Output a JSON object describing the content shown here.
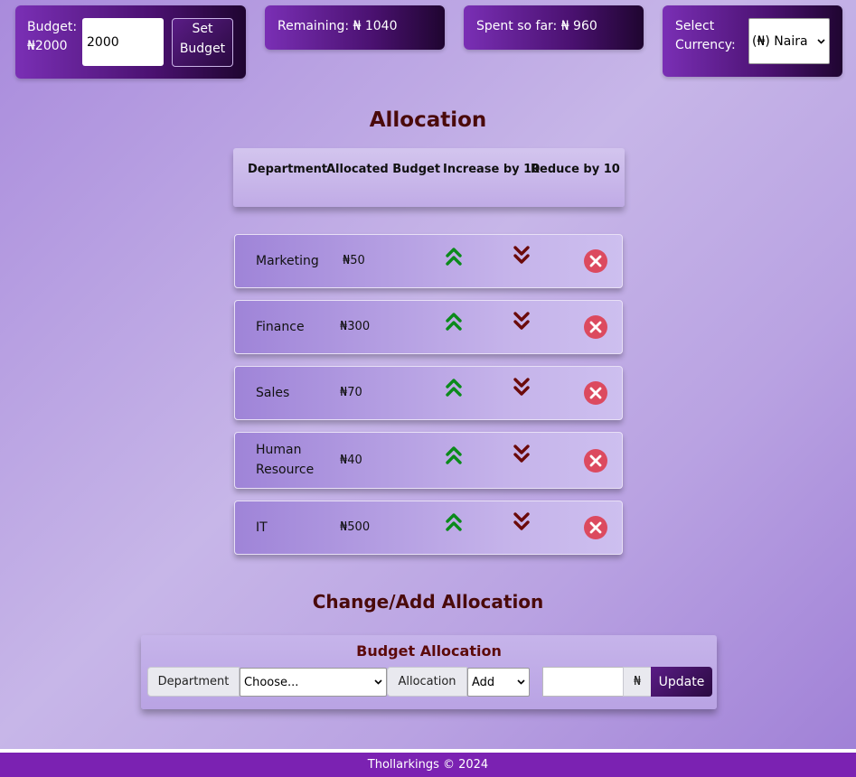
{
  "budget": {
    "label": "Budget: ₦2000",
    "input_value": "2000",
    "set_button": "Set Budget"
  },
  "remaining": {
    "text": "Remaining: ₦ 1040"
  },
  "spent": {
    "text": "Spent so far: ₦ 960"
  },
  "currency": {
    "label": "Select Currency:",
    "selected": "(₦) Naira"
  },
  "allocation": {
    "title": "Allocation",
    "headers": {
      "department": "Department",
      "allocated": "Allocated Budget",
      "increase": "Increase by 10",
      "reduce": "Reduce by 10"
    },
    "rows": [
      {
        "department": "Marketing",
        "amount": "₦50"
      },
      {
        "department": "Finance",
        "amount": "₦300"
      },
      {
        "department": "Sales",
        "amount": "₦70"
      },
      {
        "department": "Human Resource",
        "amount": "₦40"
      },
      {
        "department": "IT",
        "amount": "₦500"
      }
    ]
  },
  "change": {
    "title": "Change/Add Allocation",
    "form_title": "Budget Allocation",
    "department_label": "Department",
    "department_select": "Choose...",
    "allocation_label": "Allocation",
    "allocation_select": "Add",
    "amount_value": "",
    "currency_symbol": "₦",
    "update_button": "Update"
  },
  "footer": {
    "text": "Thollarkings © 2024"
  },
  "colors": {
    "card_gradient_start": "#7a2fb5",
    "card_gradient_end": "#1f0530",
    "up_icon": "#0a8a1a",
    "down_icon": "#6b0a0a",
    "delete_icon": "#dc4a5f",
    "title_color": "#4a0a0a",
    "footer_bg": "#7b22b2"
  },
  "icons": {
    "increase": "double-chevron-up-icon",
    "decrease": "double-chevron-down-icon",
    "delete": "circle-x-icon"
  }
}
